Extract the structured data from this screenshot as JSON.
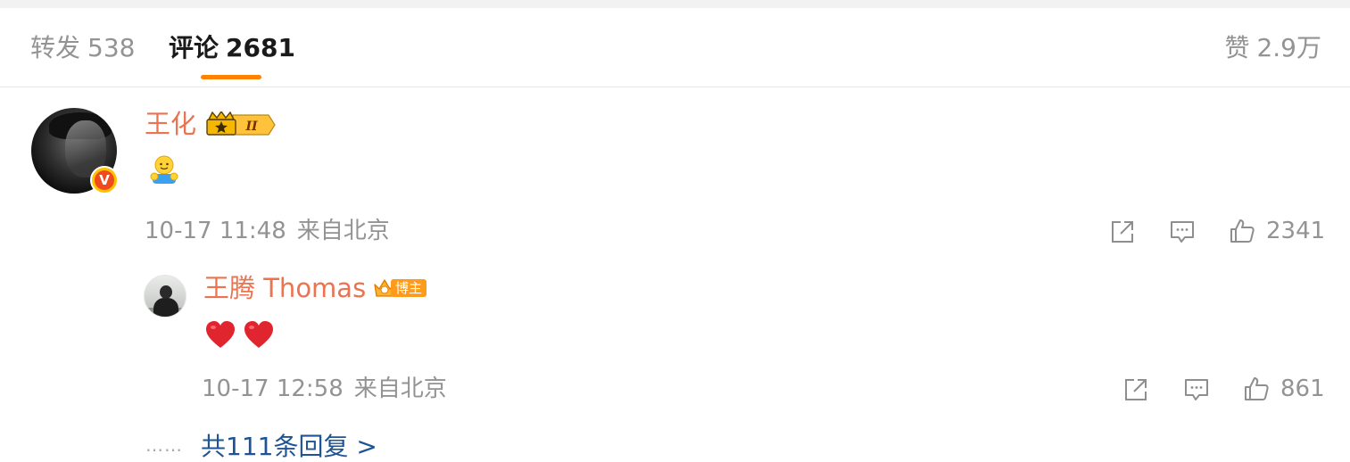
{
  "tabs": {
    "repost": {
      "label": "转发",
      "count": "538"
    },
    "comment": {
      "label": "评论",
      "count": "2681"
    },
    "like": {
      "label": "赞",
      "count": "2.9万"
    }
  },
  "comment": {
    "username": "王化",
    "crown_level": "II",
    "verify_mark": "V",
    "content_emoji": "hug-emoji",
    "time": "10-17 11:48",
    "source": "来自北京",
    "like_count": "2341"
  },
  "reply": {
    "username": "王腾 Thomas",
    "badge_label": "博主",
    "content_emoji": [
      "heart-emoji",
      "heart-emoji"
    ],
    "time": "10-17 12:58",
    "source": "来自北京",
    "like_count": "861"
  },
  "more_replies": {
    "dots": "……",
    "label": "共111条回复 >"
  },
  "colors": {
    "accent": "#ff8200",
    "username": "#eb7350",
    "link": "#1e5493",
    "muted": "#939393",
    "heart": "#e0252f"
  }
}
